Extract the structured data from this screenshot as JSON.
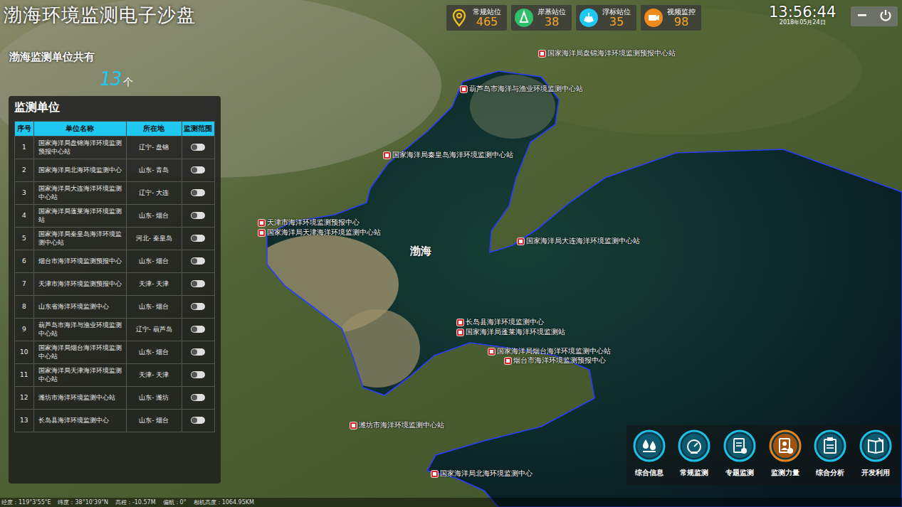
{
  "title": "渤海环境监测电子沙盘",
  "stats": [
    {
      "label": "常规站位",
      "value": "465",
      "color": "#f0c020"
    },
    {
      "label": "岸基站位",
      "value": "38",
      "color": "#2fbf6a"
    },
    {
      "label": "浮标站位",
      "value": "35",
      "color": "#1ec8f0"
    },
    {
      "label": "视频监控",
      "value": "98",
      "color": "#f08a1a"
    }
  ],
  "clock": {
    "time": "13:56:44",
    "date": "2018年05月24日"
  },
  "summary": {
    "label": "渤海监测单位共有",
    "count": "13",
    "unit": "个"
  },
  "panel": {
    "title": "监测单位",
    "columns": [
      "序号",
      "单位名称",
      "所在地",
      "监测范围"
    ],
    "rows": [
      {
        "index": "1",
        "name": "国家海洋局盘锦海洋环境监测预报中心站",
        "location": "辽宁- 盘锦",
        "on": false
      },
      {
        "index": "2",
        "name": "国家海洋局北海环境监测中心",
        "location": "山东- 青岛",
        "on": false
      },
      {
        "index": "3",
        "name": "国家海洋局大连海洋环境监测中心站",
        "location": "辽宁- 大连",
        "on": false
      },
      {
        "index": "4",
        "name": "国家海洋局蓬莱海洋环境监测站",
        "location": "山东- 烟台",
        "on": false
      },
      {
        "index": "5",
        "name": "国家海洋局秦皇岛海洋环境监测中心站",
        "location": "河北- 秦皇岛",
        "on": false
      },
      {
        "index": "6",
        "name": "烟台市海洋环境监测预报中心",
        "location": "山东- 烟台",
        "on": false
      },
      {
        "index": "7",
        "name": "天津市海洋环境监测预报中心",
        "location": "天津- 天津",
        "on": false
      },
      {
        "index": "8",
        "name": "山东省海洋环境监测中心",
        "location": "山东- 烟台",
        "on": false
      },
      {
        "index": "9",
        "name": "葫芦岛市海洋与渔业环境监测中心站",
        "location": "辽宁- 葫芦岛",
        "on": false
      },
      {
        "index": "10",
        "name": "国家海洋局烟台海洋环境监测中心站",
        "location": "山东- 烟台",
        "on": false
      },
      {
        "index": "11",
        "name": "国家海洋局天津海洋环境监测中心站",
        "location": "天津- 天津",
        "on": false
      },
      {
        "index": "12",
        "name": "潍坊市海洋环境监测中心站",
        "location": "山东- 潍坊",
        "on": false
      },
      {
        "index": "13",
        "name": "长岛县海洋环境监测中心",
        "location": "山东- 烟台",
        "on": false
      }
    ]
  },
  "map": {
    "sea_label": "渤海",
    "pins": [
      "国家海洋局盘锦海洋环境监测预报中心站",
      "葫芦岛市海洋与渔业环境监测中心站",
      "国家海洋局秦皇岛海洋环境监测中心站",
      "天津市海洋环境监测预报中心",
      "国家海洋局天津海洋环境监测中心站",
      "国家海洋局大连海洋环境监测中心站",
      "长岛县海洋环境监测中心",
      "国家海洋局蓬莱海洋环境监测站",
      "国家海洋局烟台海洋环境监测中心站",
      "烟台市海洋环境监测预报中心",
      "潍坊市海洋环境监测中心站",
      "国家海洋局北海环境监测中心"
    ]
  },
  "nav": [
    {
      "label": "综合信息",
      "selected": false
    },
    {
      "label": "常规监测",
      "selected": false
    },
    {
      "label": "专题监测",
      "selected": false
    },
    {
      "label": "监测力量",
      "selected": true
    },
    {
      "label": "综合分析",
      "selected": false
    },
    {
      "label": "开发利用",
      "selected": false
    }
  ],
  "status_bar": [
    "经度：119°3'55\"E",
    "纬度：38°10'39\"N",
    "高程：-10.57M",
    "偏航：0°",
    "相机高度：1064.95KM"
  ]
}
